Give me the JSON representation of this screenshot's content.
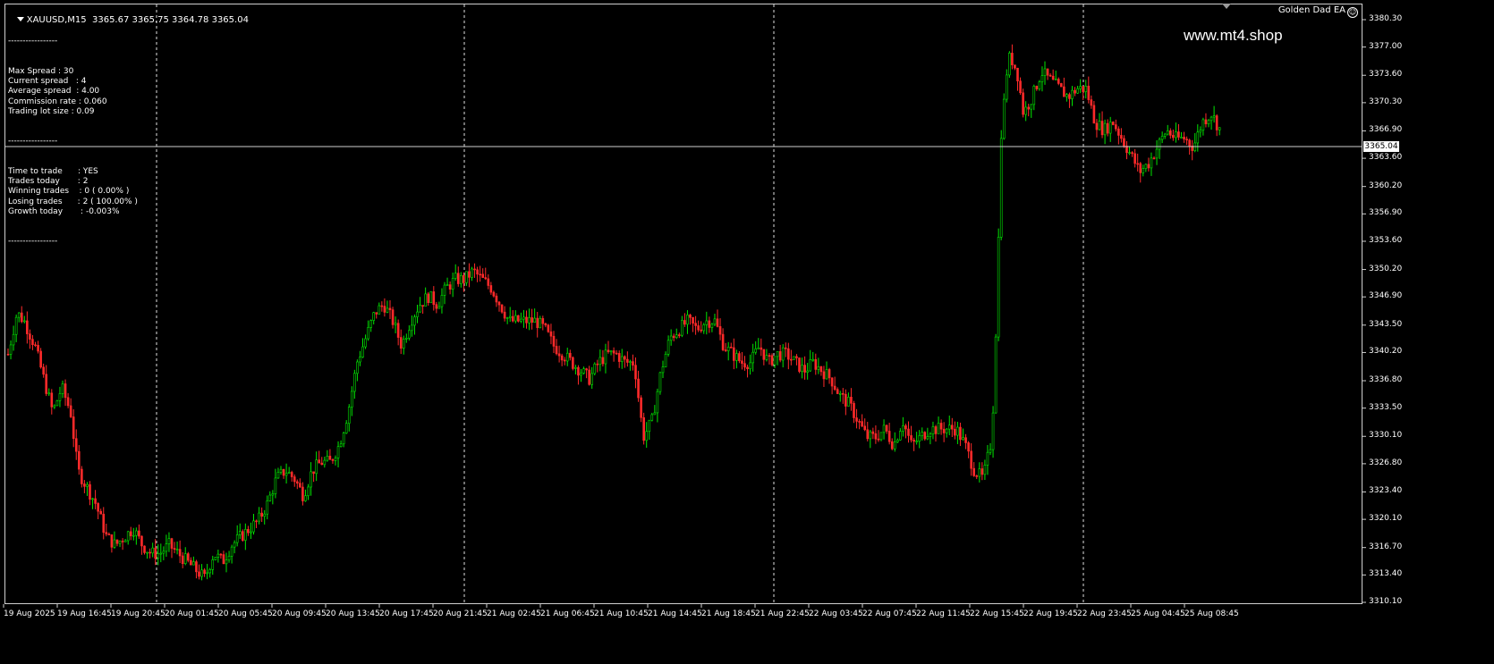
{
  "chart": {
    "symbol_header": "XAUUSD,M15  3365.67 3365.75 3364.78 3365.04",
    "ea_name": "Golden Dad EA",
    "watermark": "www.mt4.shop",
    "current_price": "3365.04"
  },
  "info_panel": {
    "separator": "-----------------",
    "rows": [
      {
        "label": "Max Spread : 30"
      },
      {
        "label": "Current spread   : 4"
      },
      {
        "label": "Average spread  : 4.00"
      },
      {
        "label": "Commission rate : 0.060"
      },
      {
        "label": "Trading lot size : 0.09"
      }
    ],
    "rows2": [
      {
        "label": "Time to trade      : YES"
      },
      {
        "label": "Trades today       : 2"
      },
      {
        "label": "Winning trades    : 0 ( 0.00% )"
      },
      {
        "label": "Losing trades      : 2 ( 100.00% )"
      },
      {
        "label": "Growth today       : -0.003%"
      }
    ]
  },
  "chart_data": {
    "type": "candlestick",
    "y_axis_ticks": [
      "3380.30",
      "3377.00",
      "3373.60",
      "3370.30",
      "3366.90",
      "3363.60",
      "3360.20",
      "3356.90",
      "3353.60",
      "3350.20",
      "3346.90",
      "3343.50",
      "3340.20",
      "3336.80",
      "3333.50",
      "3330.10",
      "3326.80",
      "3323.40",
      "3320.10",
      "3316.70",
      "3313.40",
      "3310.10"
    ],
    "ylim": [
      3310.1,
      3380.3
    ],
    "x_axis_labels": [
      "19 Aug 2025",
      "19 Aug 16:45",
      "19 Aug 20:45",
      "20 Aug 01:45",
      "20 Aug 05:45",
      "20 Aug 09:45",
      "20 Aug 13:45",
      "20 Aug 17:45",
      "20 Aug 21:45",
      "21 Aug 02:45",
      "21 Aug 06:45",
      "21 Aug 10:45",
      "21 Aug 14:45",
      "21 Aug 18:45",
      "21 Aug 22:45",
      "22 Aug 03:45",
      "22 Aug 07:45",
      "22 Aug 11:45",
      "22 Aug 15:45",
      "22 Aug 19:45",
      "22 Aug 23:45",
      "25 Aug 04:45",
      "25 Aug 08:45"
    ],
    "close_path": [
      [
        0,
        3340
      ],
      [
        10,
        3345
      ],
      [
        18,
        3344
      ],
      [
        30,
        3341
      ],
      [
        40,
        3337
      ],
      [
        50,
        3333
      ],
      [
        60,
        3336
      ],
      [
        70,
        3333
      ],
      [
        78,
        3326
      ],
      [
        88,
        3324
      ],
      [
        98,
        3322
      ],
      [
        110,
        3318
      ],
      [
        120,
        3317
      ],
      [
        130,
        3318
      ],
      [
        140,
        3319
      ],
      [
        150,
        3317
      ],
      [
        160,
        3316
      ],
      [
        170,
        3316
      ],
      [
        180,
        3317
      ],
      [
        190,
        3316
      ],
      [
        200,
        3315
      ],
      [
        210,
        3314
      ],
      [
        220,
        3313
      ],
      [
        230,
        3316
      ],
      [
        240,
        3315
      ],
      [
        250,
        3317
      ],
      [
        260,
        3318
      ],
      [
        270,
        3319
      ],
      [
        280,
        3320
      ],
      [
        290,
        3322
      ],
      [
        300,
        3325
      ],
      [
        310,
        3326
      ],
      [
        320,
        3325
      ],
      [
        330,
        3323
      ],
      [
        340,
        3326
      ],
      [
        350,
        3327
      ],
      [
        360,
        3327
      ],
      [
        370,
        3329
      ],
      [
        380,
        3333
      ],
      [
        390,
        3339
      ],
      [
        400,
        3342
      ],
      [
        410,
        3345
      ],
      [
        420,
        3346
      ],
      [
        430,
        3344
      ],
      [
        440,
        3341
      ],
      [
        450,
        3344
      ],
      [
        460,
        3346
      ],
      [
        470,
        3347
      ],
      [
        480,
        3346
      ],
      [
        490,
        3348
      ],
      [
        500,
        3349
      ],
      [
        510,
        3349
      ],
      [
        520,
        3350
      ],
      [
        530,
        3349
      ],
      [
        540,
        3348
      ],
      [
        550,
        3346
      ],
      [
        560,
        3344
      ],
      [
        570,
        3344
      ],
      [
        580,
        3344
      ],
      [
        590,
        3344
      ],
      [
        600,
        3343
      ],
      [
        610,
        3341
      ],
      [
        620,
        3340
      ],
      [
        630,
        3339
      ],
      [
        640,
        3338
      ],
      [
        650,
        3337
      ],
      [
        660,
        3339
      ],
      [
        670,
        3340
      ],
      [
        680,
        3340
      ],
      [
        690,
        3339
      ],
      [
        700,
        3339
      ],
      [
        710,
        3330
      ],
      [
        720,
        3332
      ],
      [
        730,
        3338
      ],
      [
        740,
        3342
      ],
      [
        750,
        3343
      ],
      [
        760,
        3344
      ],
      [
        770,
        3343
      ],
      [
        780,
        3344
      ],
      [
        790,
        3344
      ],
      [
        800,
        3341
      ],
      [
        810,
        3340
      ],
      [
        820,
        3339
      ],
      [
        830,
        3339
      ],
      [
        840,
        3341
      ],
      [
        850,
        3339
      ],
      [
        860,
        3340
      ],
      [
        870,
        3340
      ],
      [
        880,
        3339
      ],
      [
        890,
        3338
      ],
      [
        900,
        3339
      ],
      [
        910,
        3338
      ],
      [
        920,
        3337
      ],
      [
        930,
        3335
      ],
      [
        940,
        3334
      ],
      [
        950,
        3332
      ],
      [
        960,
        3330
      ],
      [
        970,
        3330
      ],
      [
        980,
        3331
      ],
      [
        990,
        3329
      ],
      [
        1000,
        3332
      ],
      [
        1010,
        3329
      ],
      [
        1020,
        3330
      ],
      [
        1030,
        3331
      ],
      [
        1040,
        3331
      ],
      [
        1050,
        3331
      ],
      [
        1060,
        3331
      ],
      [
        1070,
        3329
      ],
      [
        1080,
        3326
      ],
      [
        1090,
        3325
      ],
      [
        1100,
        3330
      ],
      [
        1105,
        3345
      ],
      [
        1110,
        3366
      ],
      [
        1115,
        3373
      ],
      [
        1120,
        3376
      ],
      [
        1128,
        3374
      ],
      [
        1135,
        3369
      ],
      [
        1145,
        3371
      ],
      [
        1155,
        3374
      ],
      [
        1165,
        3373
      ],
      [
        1175,
        3372
      ],
      [
        1185,
        3371
      ],
      [
        1195,
        3372
      ],
      [
        1205,
        3372
      ],
      [
        1215,
        3368
      ],
      [
        1225,
        3367
      ],
      [
        1235,
        3368
      ],
      [
        1245,
        3366
      ],
      [
        1255,
        3364
      ],
      [
        1265,
        3362
      ],
      [
        1275,
        3363
      ],
      [
        1285,
        3365
      ],
      [
        1295,
        3367
      ],
      [
        1305,
        3366
      ],
      [
        1315,
        3366
      ],
      [
        1325,
        3365
      ],
      [
        1335,
        3368
      ],
      [
        1345,
        3369
      ],
      [
        1355,
        3367
      ],
      [
        1365,
        3365
      ]
    ]
  }
}
